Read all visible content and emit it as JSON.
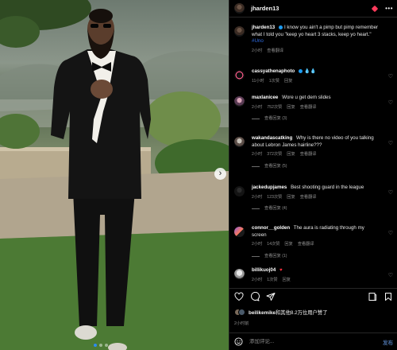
{
  "post": {
    "username": "jharden13",
    "more": "•••"
  },
  "caption": {
    "username": "jharden13",
    "text": "I know you ain't a pimp but pimp remember what I told you \"keep yo heart 3 stacks, keep yo heart.\"",
    "hashtag": "#Uno",
    "time": "2小时"
  },
  "comments": [
    {
      "username": "cassyathenaphoto",
      "text": "",
      "time": "11小时",
      "likes": "1次赞",
      "reply": "回复"
    },
    {
      "username": "maxlanicee",
      "text": "Wore u get dem slides",
      "time": "2小时",
      "likes": "752次赞",
      "reply": "回复",
      "translate": "查看翻译",
      "replies": "查看回复 (3)"
    },
    {
      "username": "wakandascatking",
      "text": "Why is there no video of you talking about Lebron James hairline???",
      "time": "2小时",
      "likes": "372次赞",
      "reply": "回复",
      "translate": "查看翻译",
      "replies": "查看回复 (5)"
    },
    {
      "username": "jackedupjames",
      "text": "Best shooting guard in the league",
      "time": "2小时",
      "likes": "123次赞",
      "reply": "回复",
      "translate": "查看翻译",
      "replies": "查看回复 (4)"
    },
    {
      "username": "connor__golden",
      "text": "The aura is radiating through my screen",
      "time": "2小时",
      "likes": "14次赞",
      "reply": "回复",
      "translate": "查看翻译",
      "replies": "查看回复 (1)"
    },
    {
      "username": "billikuoj04",
      "text": "",
      "time": "2小时",
      "likes": "1次赞",
      "reply": "回复"
    }
  ],
  "caption_labels": {
    "translate": "查看翻译"
  },
  "likes": {
    "name": "beilikemike",
    "summary": "和其他8.2万位用户赞了"
  },
  "post_time": "2小时前",
  "add_comment": {
    "placeholder": "添加评论...",
    "post": "发布"
  },
  "colors": {
    "verified": "#1d9bf0",
    "mention": "#2f6ee8",
    "heart": "#ff3040"
  }
}
